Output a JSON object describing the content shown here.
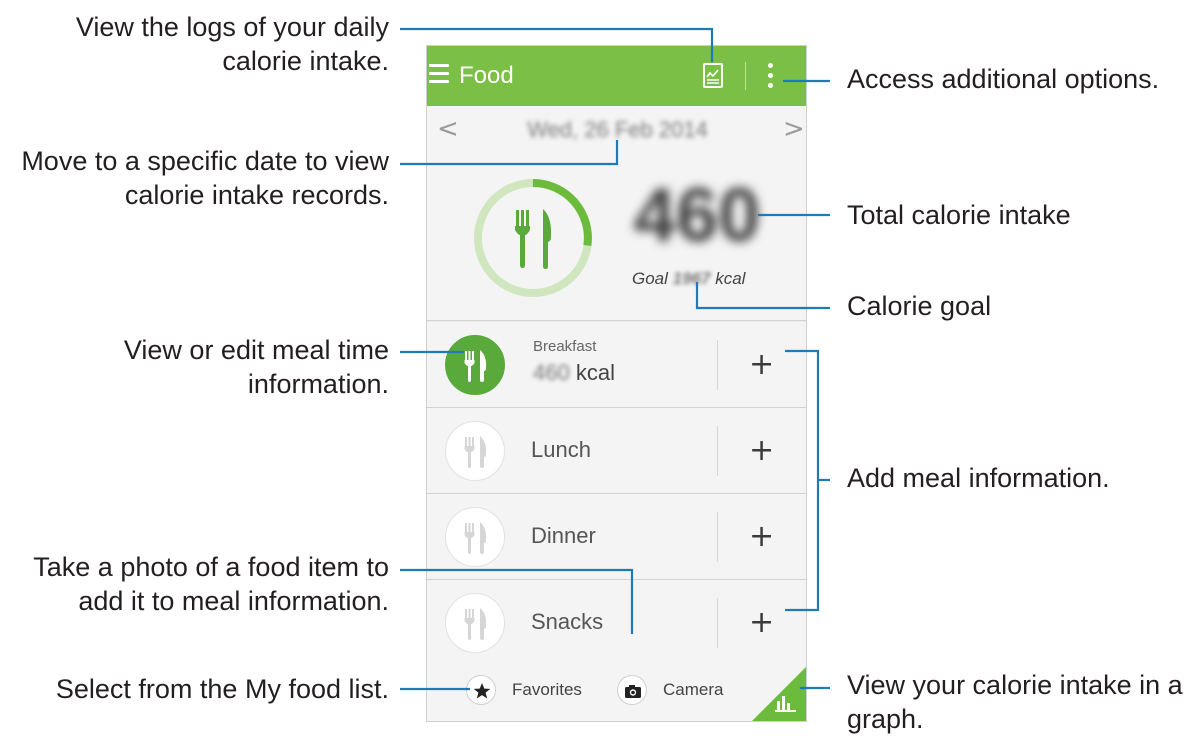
{
  "app": {
    "title": "Food",
    "date": "Wed, 26 Feb 2014",
    "prev_arrow": "<",
    "next_arrow": ">",
    "total_value": "460",
    "goal_prefix": "Goal",
    "goal_value": "1967",
    "goal_unit": "kcal",
    "meals": [
      {
        "name": "Breakfast",
        "kcal_value": "460",
        "kcal_unit": "kcal",
        "active": true
      },
      {
        "name": "Lunch",
        "active": false
      },
      {
        "name": "Dinner",
        "active": false
      },
      {
        "name": "Snacks",
        "active": false
      }
    ],
    "add_symbol": "+",
    "favorites_label": "Favorites",
    "camera_label": "Camera",
    "icons": [
      "menu-icon",
      "logs-icon",
      "more-options-icon",
      "fork-knife-icon",
      "star-icon",
      "camera-icon",
      "graph-icon"
    ],
    "colors": {
      "accent": "#7bbf47",
      "dark_accent": "#5aa93b",
      "ring": "#6cbb3c",
      "callout_line": "#1f7ab8"
    }
  },
  "callouts": {
    "logs": [
      "View the logs of your daily",
      "calorie intake."
    ],
    "date": [
      "Move to a specific date to view",
      "calorie intake records."
    ],
    "meal_edit": [
      "View or edit meal time",
      "information."
    ],
    "camera": [
      "Take a photo of a food item to",
      "add it to meal information."
    ],
    "favorites": [
      "Select from the My food list."
    ],
    "options": [
      "Access additional options."
    ],
    "total": [
      "Total calorie intake"
    ],
    "goal": [
      "Calorie goal"
    ],
    "add_meal": [
      "Add meal information."
    ],
    "graph": [
      "View your calorie intake in a",
      "graph."
    ]
  }
}
